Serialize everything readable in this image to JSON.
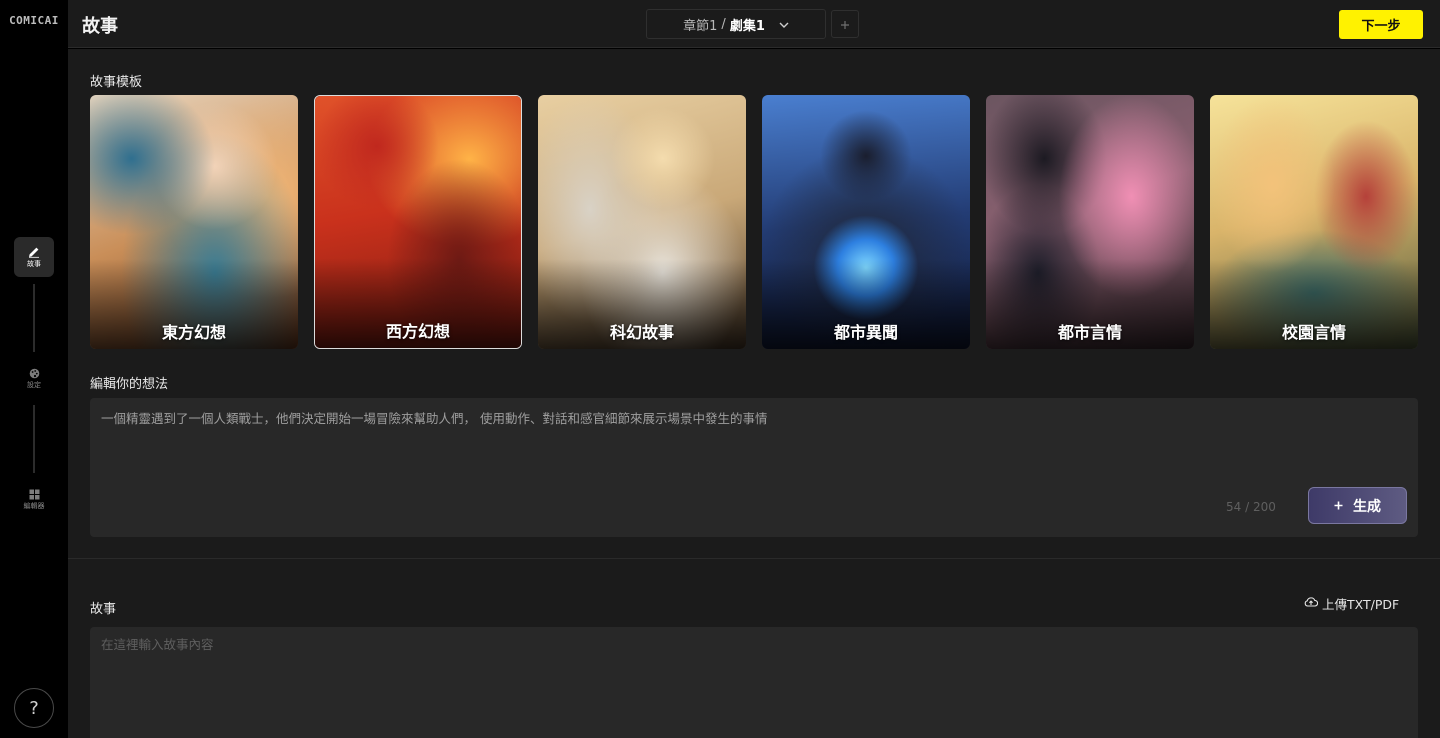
{
  "app": {
    "logo": "COMICAI"
  },
  "sidebar": {
    "items": [
      {
        "label": "故事",
        "icon": "pencil-icon",
        "active": true
      },
      {
        "label": "設定",
        "icon": "palette-icon",
        "active": false
      },
      {
        "label": "編輯器",
        "icon": "layout-grid-icon",
        "active": false
      }
    ],
    "help": "?"
  },
  "header": {
    "title": "故事",
    "chapter": "章節1",
    "separator": "/",
    "episode": "劇集1",
    "next_label": "下一步"
  },
  "templates": {
    "heading": "故事模板",
    "selected_index": 1,
    "items": [
      {
        "name": "東方幻想"
      },
      {
        "name": "西方幻想"
      },
      {
        "name": "科幻故事"
      },
      {
        "name": "都市異聞"
      },
      {
        "name": "都市言情"
      },
      {
        "name": "校園言情"
      }
    ]
  },
  "idea": {
    "heading": "編輯你的想法",
    "text": "一個精靈遇到了一個人類戰士，他們決定開始一場冒險來幫助人們， 使用動作、對話和感官細節來展示場景中發生的事情",
    "counter": "54 / 200",
    "generate_label": "生成"
  },
  "story": {
    "heading": "故事",
    "upload_label": "上傳TXT/PDF",
    "placeholder": "在這裡輸入故事內容"
  },
  "colors": {
    "accent_yellow": "#fff200",
    "generate_purple": "#4e4a78",
    "panel": "#1b1b1b",
    "input_bg": "#282828"
  }
}
